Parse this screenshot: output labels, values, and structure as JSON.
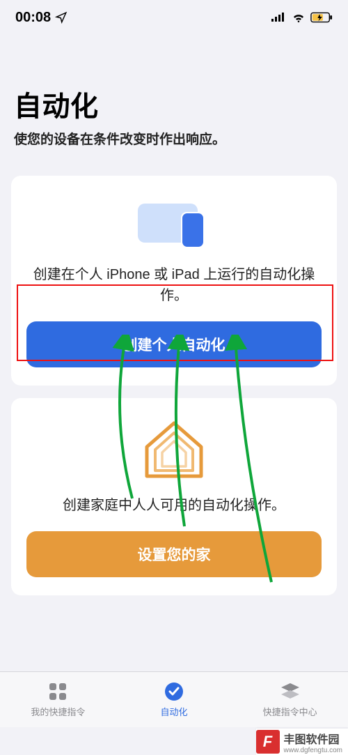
{
  "status": {
    "time": "00:08",
    "icons": {
      "location": "location-arrow",
      "signal": "antenna-bars",
      "wifi": "wifi",
      "battery": "battery-charging"
    }
  },
  "header": {
    "title": "自动化",
    "subtitle": "使您的设备在条件改变时作出响应。"
  },
  "cards": {
    "personal": {
      "desc": "创建在个人 iPhone 或 iPad 上运行的自动化操作。",
      "button": "创建个人自动化"
    },
    "home": {
      "desc": "创建家庭中人人可用的自动化操作。",
      "button": "设置您的家"
    }
  },
  "tabs": {
    "shortcuts": "我的快捷指令",
    "automation": "自动化",
    "gallery": "快捷指令中心",
    "active": "automation"
  },
  "watermark": {
    "badge": "F",
    "text": "丰图软件园",
    "url": "www.dgfengtu.com"
  },
  "colors": {
    "accent_blue": "#2f6be0",
    "accent_orange": "#e69a3b",
    "highlight_red": "#e11",
    "arrow_green": "#0fa63a"
  }
}
